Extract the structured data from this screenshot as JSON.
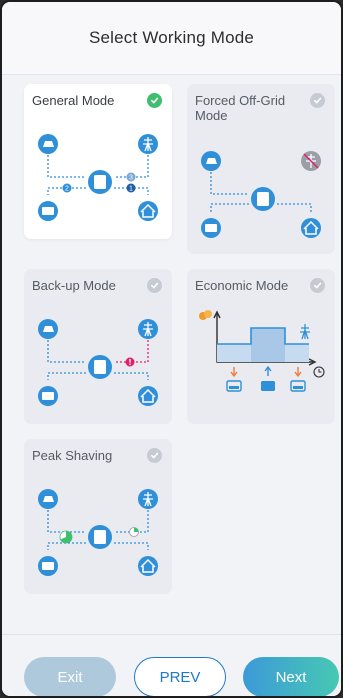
{
  "header": {
    "title": "Select Working Mode"
  },
  "modes": [
    {
      "label": "General Mode",
      "selected": true
    },
    {
      "label": "Forced Off-Grid Mode",
      "selected": false
    },
    {
      "label": "Back-up Mode",
      "selected": false
    },
    {
      "label": "Economic Mode",
      "selected": false
    },
    {
      "label": "Peak Shaving",
      "selected": false
    }
  ],
  "badges": {
    "general_a": "2",
    "general_b": "3",
    "general_c": "1"
  },
  "buttons": {
    "exit": "Exit",
    "prev": "PREV",
    "next": "Next"
  },
  "colors": {
    "accent_blue": "#1f78c8",
    "node_blue": "#2f8fd8",
    "check_green": "#3fbf6e",
    "check_gray": "#c6cad3",
    "alert_pink": "#e0206a",
    "arrow_orange": "#f07a3a",
    "solar_orange": "#f09a2a"
  }
}
